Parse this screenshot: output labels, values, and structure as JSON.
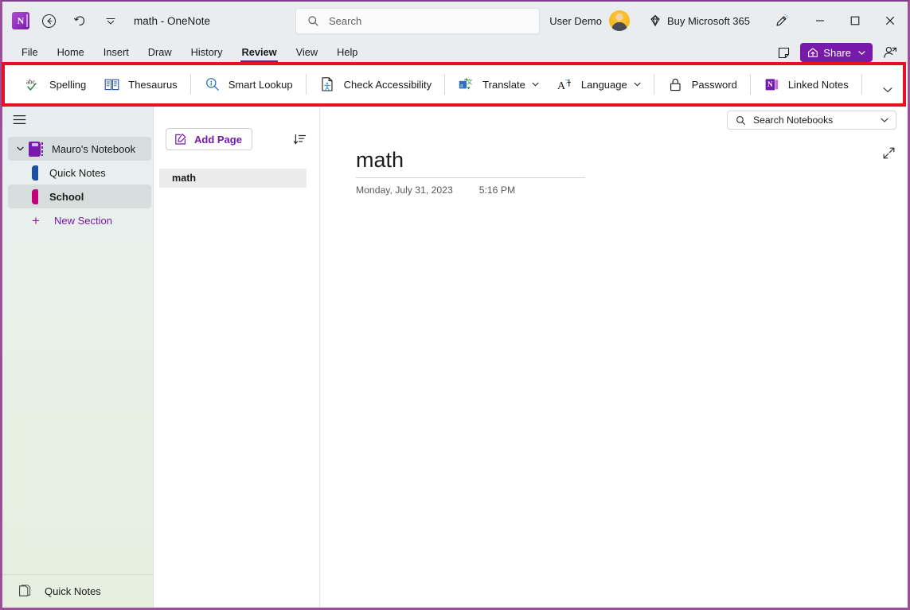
{
  "window": {
    "title": "math  -  OneNote",
    "app_icon": "onenote-logo-icon",
    "back_icon": "back-arrow-icon",
    "undo_icon": "undo-icon",
    "quick_access_icon": "quick-access-toolbar-icon"
  },
  "search": {
    "placeholder": "Search",
    "icon": "search-icon"
  },
  "account": {
    "user_name": "User Demo",
    "avatar": "user-avatar",
    "buy_label": "Buy Microsoft 365",
    "buy_icon": "diamond-icon",
    "pen_icon": "ink-pen-icon"
  },
  "window_controls": {
    "minimize": "—",
    "maximize": "☐",
    "close": "✕"
  },
  "menubar": {
    "items": [
      {
        "label": "File",
        "active": false
      },
      {
        "label": "Home",
        "active": false
      },
      {
        "label": "Insert",
        "active": false
      },
      {
        "label": "Draw",
        "active": false
      },
      {
        "label": "History",
        "active": false
      },
      {
        "label": "Review",
        "active": true
      },
      {
        "label": "View",
        "active": false
      },
      {
        "label": "Help",
        "active": false
      }
    ],
    "notes_icon": "sticky-note-icon",
    "share_label": "Share",
    "share_icon": "share-icon",
    "share_caret": "⌄",
    "people_icon": "add-people-icon"
  },
  "ribbon": {
    "highlight_color": "#e81123",
    "items": [
      {
        "label": "Spelling",
        "icon": "spelling-abc-check-icon",
        "caret": false,
        "sep_after": false
      },
      {
        "label": "Thesaurus",
        "icon": "thesaurus-book-icon",
        "caret": false,
        "sep_after": true
      },
      {
        "label": "Smart Lookup",
        "icon": "smart-lookup-magnifier-icon",
        "caret": false,
        "sep_after": true
      },
      {
        "label": "Check Accessibility",
        "icon": "check-accessibility-icon",
        "caret": false,
        "sep_after": true
      },
      {
        "label": "Translate",
        "icon": "translate-icon",
        "caret": true,
        "sep_after": false
      },
      {
        "label": "Language",
        "icon": "language-icon",
        "caret": true,
        "sep_after": true
      },
      {
        "label": "Password",
        "icon": "padlock-icon",
        "caret": false,
        "sep_after": true
      },
      {
        "label": "Linked Notes",
        "icon": "linked-notes-onenote-icon",
        "caret": false,
        "sep_after": true
      }
    ],
    "expand_icon": "chevron-down-icon"
  },
  "navigation": {
    "hamburger_icon": "hamburger-menu-icon",
    "notebook": {
      "label": "Mauro's Notebook",
      "icon": "notebook-icon",
      "expanded": true,
      "chevron": "⌄",
      "selected": true
    },
    "sections": [
      {
        "label": "Quick Notes",
        "color": "#1f4fa0",
        "selected": false,
        "bold": false
      },
      {
        "label": "School",
        "color": "#c2007b",
        "selected": true,
        "bold": true
      }
    ],
    "new_section": {
      "label": "New Section",
      "icon": "plus-icon"
    },
    "bottom": {
      "label": "Quick Notes",
      "icon": "quick-notes-page-icon"
    }
  },
  "pagepane": {
    "add_page_label": "Add Page",
    "add_page_icon": "add-page-icon",
    "sort_icon": "sort-pages-icon",
    "pages": [
      {
        "title": "math",
        "selected": true
      }
    ]
  },
  "notebook_search": {
    "placeholder": "Search Notebooks",
    "icon": "search-icon",
    "caret": "⌄"
  },
  "editor": {
    "page_title": "math",
    "date": "Monday, July 31, 2023",
    "time": "5:16 PM",
    "expand_icon": "expand-diagonal-icon"
  },
  "colors": {
    "accent": "#7719aa",
    "titlebar_bg": "#e9edf0",
    "highlight": "#e81123",
    "window_border": "#9b4f96"
  }
}
